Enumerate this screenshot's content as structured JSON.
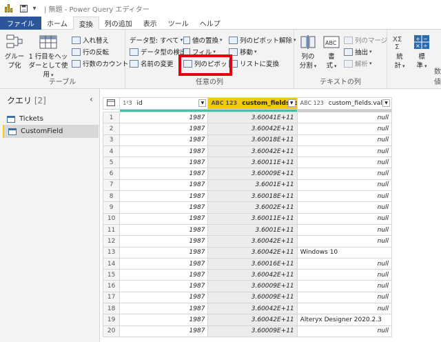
{
  "title_bar": {
    "title": "| 無題 - Power Query エディター"
  },
  "tabs": [
    "ファイル",
    "ホーム",
    "変換",
    "列の追加",
    "表示",
    "ツール",
    "ヘルプ"
  ],
  "ribbon": {
    "table_group": {
      "group_by_l1": "グルー",
      "group_by_l2": "プ化",
      "first_row_l1": "1 行目をヘッ",
      "first_row_l2": "ダーとして使用",
      "transpose": "入れ替え",
      "reverse_rows": "行の反転",
      "count_rows": "行数のカウント",
      "label": "テーブル"
    },
    "any_column_group": {
      "data_type": "データ型: すべて",
      "detect_type": "データ型の検出",
      "rename": "名前の変更",
      "replace_values": "値の置換",
      "fill": "フィル",
      "pivot": "列のピボット",
      "unpivot": "列のピボット解除",
      "move": "移動",
      "to_list": "リストに変換",
      "label": "任意の列"
    },
    "text_column_group": {
      "split_l1": "列の",
      "split_l2": "分割",
      "format_l1": "書",
      "format_l2": "式",
      "merge": "列のマージ",
      "extract": "抽出",
      "parse": "解析",
      "label": "テキストの列"
    },
    "number_group": {
      "stats_l1": "統",
      "stats_l2": "計",
      "standard_l1": "標",
      "standard_l2": "準",
      "label": "数値"
    }
  },
  "query_pane": {
    "title": "クエリ",
    "count": "[2]",
    "queries": [
      "Tickets",
      "CustomField"
    ],
    "selected": "CustomField"
  },
  "grid": {
    "columns": [
      {
        "type": "1²3",
        "name": "id"
      },
      {
        "type": "ABC 123",
        "name": "custom_fields.id"
      },
      {
        "type": "ABC 123",
        "name": "custom_fields.value"
      }
    ],
    "rows": [
      [
        "1",
        "1987",
        "3.60041E+11",
        "null"
      ],
      [
        "2",
        "1987",
        "3.60042E+11",
        "null"
      ],
      [
        "3",
        "1987",
        "3.60018E+11",
        "null"
      ],
      [
        "4",
        "1987",
        "3.60042E+11",
        "null"
      ],
      [
        "5",
        "1987",
        "3.60011E+11",
        "null"
      ],
      [
        "6",
        "1987",
        "3.60009E+11",
        "null"
      ],
      [
        "7",
        "1987",
        "3.6001E+11",
        "null"
      ],
      [
        "8",
        "1987",
        "3.60018E+11",
        "null"
      ],
      [
        "9",
        "1987",
        "3.6002E+11",
        "null"
      ],
      [
        "10",
        "1987",
        "3.60011E+11",
        "null"
      ],
      [
        "11",
        "1987",
        "3.6001E+11",
        "null"
      ],
      [
        "12",
        "1987",
        "3.60042E+11",
        "null"
      ],
      [
        "13",
        "1987",
        "3.60042E+11",
        "Windows 10"
      ],
      [
        "14",
        "1987",
        "3.60016E+11",
        "null"
      ],
      [
        "15",
        "1987",
        "3.60042E+11",
        "null"
      ],
      [
        "16",
        "1987",
        "3.60009E+11",
        "null"
      ],
      [
        "17",
        "1987",
        "3.60009E+11",
        "null"
      ],
      [
        "18",
        "1987",
        "3.60042E+11",
        "null"
      ],
      [
        "19",
        "1987",
        "3.60042E+11",
        "Alteryx Designer 2020.2.3"
      ],
      [
        "20",
        "1987",
        "3.60009E+11",
        "null"
      ]
    ]
  },
  "colors": {
    "accent": "#f2c811",
    "highlight": "#e3000f",
    "file_tab": "#2b579a"
  }
}
